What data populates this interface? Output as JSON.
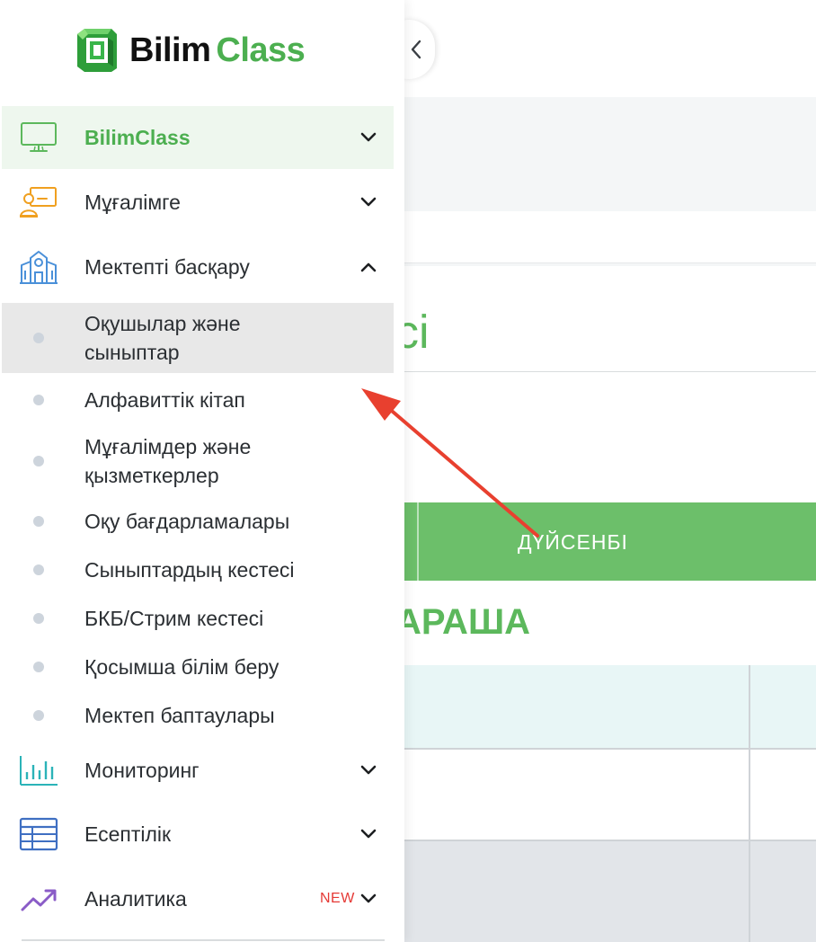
{
  "brand": {
    "name_part1": "Bilim",
    "name_part2": "Class"
  },
  "background": {
    "title_fragment": "сі",
    "day": "ДҮЙСЕНБІ",
    "heading_fragment": "АРАША"
  },
  "sidebar": {
    "items": [
      {
        "label": "BilimClass",
        "icon": "monitor-icon",
        "chevron": "down",
        "active": true
      },
      {
        "label": "Мұғалімге",
        "icon": "teacher-board-icon",
        "chevron": "down"
      },
      {
        "label": "Мектепті басқару",
        "icon": "school-building-icon",
        "chevron": "up",
        "expanded": true
      },
      {
        "label": "Мониторинг",
        "icon": "bar-chart-icon",
        "chevron": "down"
      },
      {
        "label": "Есептілік",
        "icon": "table-grid-icon",
        "chevron": "down"
      },
      {
        "label": "Аналитика",
        "icon": "trend-up-icon",
        "chevron": "down",
        "badge": "NEW"
      }
    ],
    "subitems": [
      {
        "label": "Оқушылар және сыныптар",
        "hover": true
      },
      {
        "label": "Алфавиттік кітап"
      },
      {
        "label": "Мұғалімдер және қызметкерлер"
      },
      {
        "label": "Оқу бағдарламалары"
      },
      {
        "label": "Сыныптардың кестесі"
      },
      {
        "label": "БКБ/Стрим кестесі"
      },
      {
        "label": "Қосымша білім беру"
      },
      {
        "label": "Мектеп баптаулары"
      }
    ]
  },
  "colors": {
    "brand_green": "#4caf50",
    "active_bg": "#eef7ee",
    "hover_bg": "#e8e8e8",
    "arrow_red": "#e8402f",
    "badge_red": "#e53935"
  }
}
